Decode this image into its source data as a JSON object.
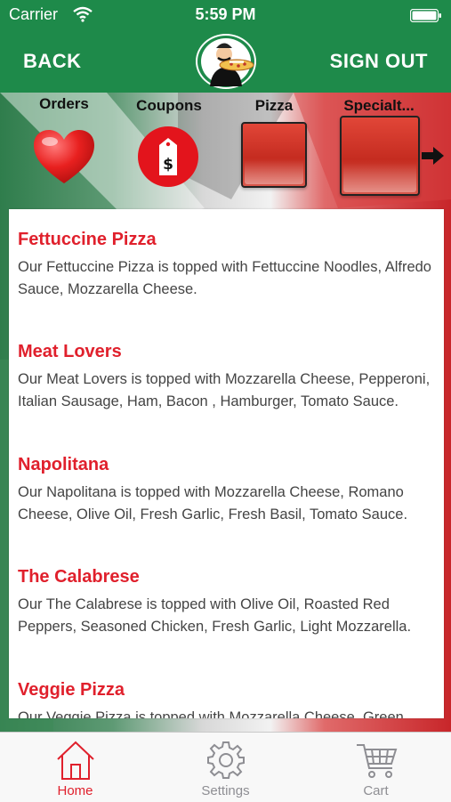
{
  "status_bar": {
    "carrier": "Carrier",
    "time": "5:59 PM"
  },
  "header": {
    "back_label": "BACK",
    "signout_label": "SIGN OUT",
    "logo_icon": "pizza-chef-logo"
  },
  "categories": [
    {
      "label": "Orders",
      "icon": "heart-icon"
    },
    {
      "label": "Coupons",
      "icon": "price-tag-icon"
    },
    {
      "label": "Pizza",
      "icon": "red-tile"
    },
    {
      "label": "Specialt...",
      "icon": "red-tile"
    }
  ],
  "scroll_arrow_icon": "arrow-right-icon",
  "menu_items": [
    {
      "name": "Fettuccine Pizza",
      "description": "Our Fettuccine Pizza is topped with Fettuccine Noodles, Alfredo Sauce, Mozzarella Cheese."
    },
    {
      "name": "Meat Lovers",
      "description": "Our Meat Lovers is topped with Mozzarella Cheese, Pepperoni, Italian Sausage, Ham, Bacon , Hamburger, Tomato Sauce."
    },
    {
      "name": "Napolitana",
      "description": "Our Napolitana is topped with Mozzarella Cheese, Romano Cheese, Olive Oil, Fresh Garlic, Fresh Basil, Tomato Sauce."
    },
    {
      "name": "The Calabrese",
      "description": "Our The Calabrese is topped with Olive Oil, Roasted Red Peppers, Seasoned Chicken, Fresh Garlic, Light Mozzarella."
    },
    {
      "name": "Veggie Pizza",
      "description": "Our Veggie Pizza is topped with Mozzarella Cheese, Green"
    }
  ],
  "tabs": [
    {
      "label": "Home",
      "icon": "home-icon",
      "active": true
    },
    {
      "label": "Settings",
      "icon": "gear-icon",
      "active": false
    },
    {
      "label": "Cart",
      "icon": "cart-icon",
      "active": false
    }
  ],
  "colors": {
    "header_green": "#1e8a4a",
    "accent_red": "#e0202c",
    "tab_inactive": "#8e8e93"
  }
}
